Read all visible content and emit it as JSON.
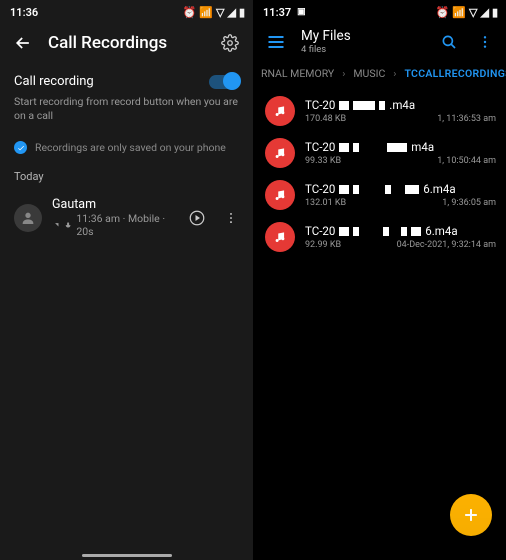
{
  "left": {
    "status": {
      "time": "11:36"
    },
    "header": {
      "title": "Call Recordings"
    },
    "toggle": {
      "label": "Call recording"
    },
    "hint": "Start recording from record button when you are on a call",
    "note": "Recordings are only saved on your phone",
    "section": "Today",
    "recording": {
      "name": "Gautam",
      "sub": "11:36 am · Mobile · 20s"
    }
  },
  "right": {
    "status": {
      "time": "11:37"
    },
    "header": {
      "title": "My Files",
      "count": "4 files"
    },
    "crumbs": {
      "a": "RNAL MEMORY",
      "b": "MUSIC",
      "c": "TCCALLRECORDINGS"
    },
    "files": [
      {
        "prefix": "TC-20",
        "ext": ".m4a",
        "size": "170.48 KB",
        "date": "1, 11:36:53 am"
      },
      {
        "prefix": "TC-20",
        "ext": "m4a",
        "size": "99.33 KB",
        "date": "1, 10:50:44 am"
      },
      {
        "prefix": "TC-20",
        "ext": "6.m4a",
        "size": "132.01 KB",
        "date": "1, 9:36:05 am"
      },
      {
        "prefix": "TC-20",
        "ext": "6.m4a",
        "size": "92.99 KB",
        "date": "04-Dec-2021, 9:32:14 am"
      }
    ]
  }
}
